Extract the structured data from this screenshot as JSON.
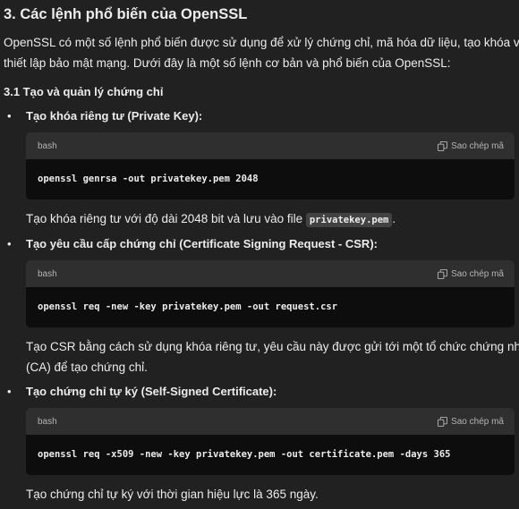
{
  "heading": "3. Các lệnh phổ biến của OpenSSL",
  "intro": [
    "OpenSSL có một số lệnh phổ biến được sử dụng để xử lý chứng chỉ, mã hóa dữ liệu, tạo khóa và",
    "thiết lập bảo mật mạng. Dưới đây là một số lệnh cơ bản và phổ biến của OpenSSL:"
  ],
  "subheading": "3.1 Tạo và quản lý chứng chỉ",
  "bullet_char": "•",
  "items": [
    {
      "label": "Tạo khóa riêng tư (Private Key):",
      "lang": "bash",
      "copy": "Sao chép mã",
      "code": "openssl genrsa -out privatekey.pem 2048",
      "desc_pre": "Tạo khóa riêng tư với độ dài 2048 bit và lưu vào file ",
      "desc_code": "privatekey.pem",
      "desc_post": "."
    },
    {
      "label": "Tạo yêu cầu cấp chứng chỉ (Certificate Signing Request - CSR):",
      "lang": "bash",
      "copy": "Sao chép mã",
      "code": "openssl req -new -key privatekey.pem -out request.csr",
      "desc": [
        "Tạo CSR bằng cách sử dụng khóa riêng tư, yêu cầu này được gửi tới một tổ chức chứng nhận",
        "(CA) để tạo chứng chỉ."
      ]
    },
    {
      "label": "Tạo chứng chỉ tự ký (Self-Signed Certificate):",
      "lang": "bash",
      "copy": "Sao chép mã",
      "code": "openssl req -x509 -new -key privatekey.pem -out certificate.pem -days 365",
      "desc": [
        "Tạo chứng chỉ tự ký với thời gian hiệu lực là 365 ngày."
      ]
    }
  ]
}
